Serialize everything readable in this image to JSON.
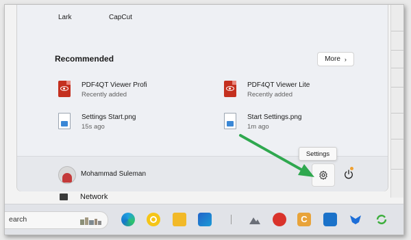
{
  "pinned": [
    "Lark",
    "CapCut"
  ],
  "recommended": {
    "title": "Recommended",
    "more_label": "More",
    "items": [
      {
        "name": "PDF4QT Viewer Profi",
        "sub": "Recently added",
        "icon": "pdf-icon"
      },
      {
        "name": "PDF4QT Viewer Lite",
        "sub": "Recently added",
        "icon": "pdf-icon"
      },
      {
        "name": "Settings Start.png",
        "sub": "15s ago",
        "icon": "image-file-icon"
      },
      {
        "name": "Start Settings.png",
        "sub": "1m ago",
        "icon": "image-file-icon"
      }
    ]
  },
  "user": {
    "name": "Mohammad Suleman"
  },
  "tooltip": "Settings",
  "network_label": "Network",
  "search": {
    "placeholder": "earch"
  },
  "colors": {
    "arrow": "#2fa84f",
    "pdf": "#c4301f",
    "accent": "#3a87d6"
  },
  "taskbar_icons": [
    "edge-icon",
    "chrome-icon",
    "file-explorer-icon",
    "store-icon",
    "app-triangle-icon",
    "app-red-circle-icon",
    "app-c-icon",
    "mail-icon",
    "app-bird-icon",
    "app-green-icon"
  ]
}
